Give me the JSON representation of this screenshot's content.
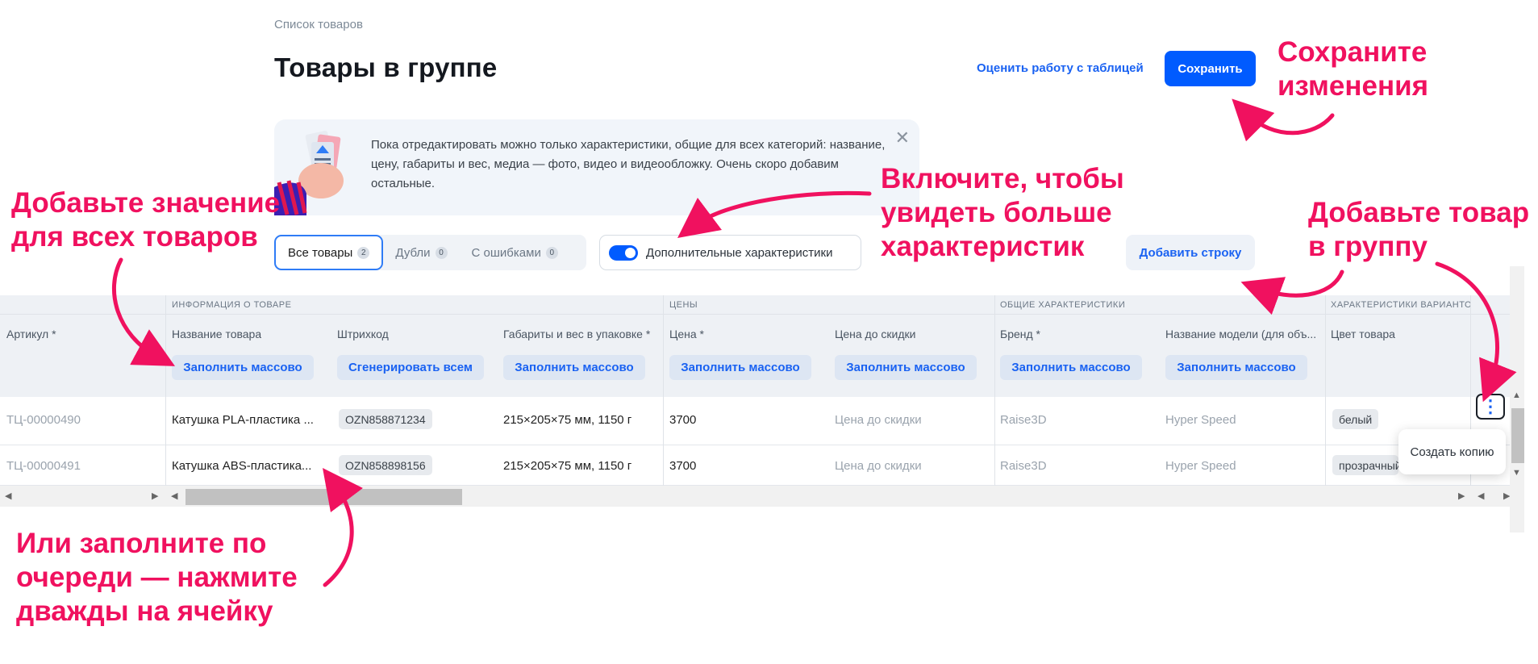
{
  "header": {
    "breadcrumb": "Список товаров",
    "title": "Товары в группе",
    "rate_link": "Оценить работу с таблицей",
    "save_label": "Сохранить"
  },
  "banner": {
    "text": "Пока отредактировать можно только характеристики, общие для всех категорий: название, цену, габариты и вес, медиа — фото, видео и видеообложку. Очень скоро добавим остальные.",
    "close": "✕"
  },
  "tabs": [
    {
      "label": "Все товары",
      "count": "2"
    },
    {
      "label": "Дубли",
      "count": "0"
    },
    {
      "label": "С ошибками",
      "count": "0"
    }
  ],
  "toggle": {
    "label": "Дополнительные характеристики",
    "on": true
  },
  "add_row_label": "Добавить строку",
  "grid": {
    "groups": [
      "ИНФОРМАЦИЯ О ТОВАРЕ",
      "ЦЕНЫ",
      "ОБЩИЕ ХАРАКТЕРИСТИКИ",
      "ХАРАКТЕРИСТИКИ ВАРИАНТОВ"
    ],
    "columns": [
      {
        "label": "Артикул *",
        "button": ""
      },
      {
        "label": "Название товара",
        "button": "Заполнить массово"
      },
      {
        "label": "Штрихкод",
        "button": "Сгенерировать всем"
      },
      {
        "label": "Габариты и вес в упаковке *",
        "button": "Заполнить массово"
      },
      {
        "label": "Цена *",
        "button": "Заполнить массово"
      },
      {
        "label": "Цена до скидки",
        "button": "Заполнить массово"
      },
      {
        "label": "Бренд *",
        "button": "Заполнить массово"
      },
      {
        "label": "Название модели (для объ...",
        "button": "Заполнить массово"
      },
      {
        "label": "Цвет товара",
        "button": ""
      }
    ],
    "rows": [
      {
        "sku": "ТЦ-00000490",
        "name": "Катушка PLA-пластика ...",
        "barcode": "OZN858871234",
        "dims": "215×205×75 мм, 1150 г",
        "price": "3700",
        "old_price": "Цена до скидки",
        "brand": "Raise3D",
        "model": "Hyper Speed",
        "color": "белый"
      },
      {
        "sku": "ТЦ-00000491",
        "name": "Катушка ABS-пластика...",
        "barcode": "OZN858898156",
        "dims": "215×205×75 мм, 1150 г",
        "price": "3700",
        "old_price": "Цена до скидки",
        "brand": "Raise3D",
        "model": "Hyper Speed",
        "color": "прозрачный"
      }
    ],
    "row_menu_icon": "⋮",
    "popup_label": "Создать копию"
  },
  "annotations": {
    "save": "Сохраните\nизменения",
    "toggle": "Включите, чтобы\nувидеть больше\nхарактеристик",
    "mass": "Добавьте значение\nдля всех товаров",
    "add": "Добавьте товар\nв группу",
    "cell": "Или заполните по\nочереди — нажмите\nдважды на ячейку"
  },
  "colors": {
    "accent": "#005bff",
    "annotation": "#f0115f"
  }
}
